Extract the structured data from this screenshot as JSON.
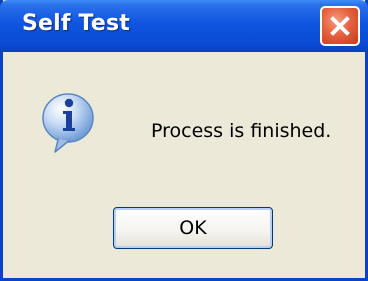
{
  "window": {
    "title": "Self Test",
    "close_icon": "close-icon"
  },
  "dialog": {
    "icon": "info-icon",
    "message": "Process is finished.",
    "ok_label": "OK"
  },
  "colors": {
    "titlebar": "#0a4fd8",
    "close_button": "#e5623f",
    "dialog_background": "#ece9d8"
  }
}
